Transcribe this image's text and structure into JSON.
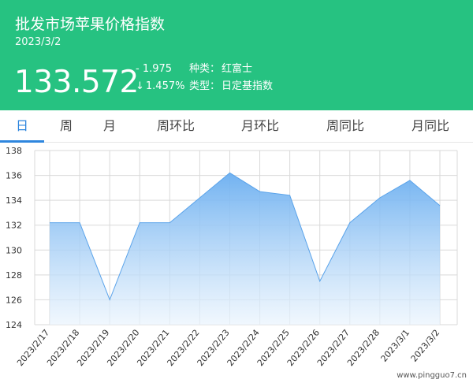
{
  "header": {
    "title": "批发市场苹果价格指数",
    "date": "2023/3/2",
    "price": "133.572",
    "change_abs": "- 1.975",
    "change_pct": "1.457%",
    "down_arrow": "↓",
    "variety_label": "种类：",
    "variety_value": "红富士",
    "type_label": "类型：",
    "type_value": "日定基指数"
  },
  "tabs": [
    {
      "label": "日",
      "active": true
    },
    {
      "label": "周",
      "active": false
    },
    {
      "label": "月",
      "active": false
    },
    {
      "label": "周环比",
      "active": false
    },
    {
      "label": "月环比",
      "active": false
    },
    {
      "label": "周同比",
      "active": false
    },
    {
      "label": "月同比",
      "active": false
    }
  ],
  "colors": {
    "header_bg": "#26c281",
    "accent": "#2e86de",
    "area_top": "#6aaef0",
    "area_bottom": "#eaf4fd",
    "line": "#5aa3ea",
    "grid": "#d9d9d9"
  },
  "chart_data": {
    "type": "area",
    "x": [
      "2023/2/17",
      "2023/2/18",
      "2023/2/19",
      "2023/2/20",
      "2023/2/21",
      "2023/2/22",
      "2023/2/23",
      "2023/2/24",
      "2023/2/25",
      "2023/2/26",
      "2023/2/27",
      "2023/2/28",
      "2023/3/1",
      "2023/3/2"
    ],
    "y": [
      132.2,
      132.2,
      126.0,
      132.2,
      132.2,
      134.2,
      136.2,
      134.7,
      134.4,
      127.5,
      132.2,
      134.2,
      135.6,
      133.572
    ],
    "yticks": [
      124,
      126,
      128,
      130,
      132,
      134,
      136,
      138
    ],
    "ylim": [
      124,
      138
    ],
    "grid": true
  },
  "watermark": "www.pingguo7.cn"
}
